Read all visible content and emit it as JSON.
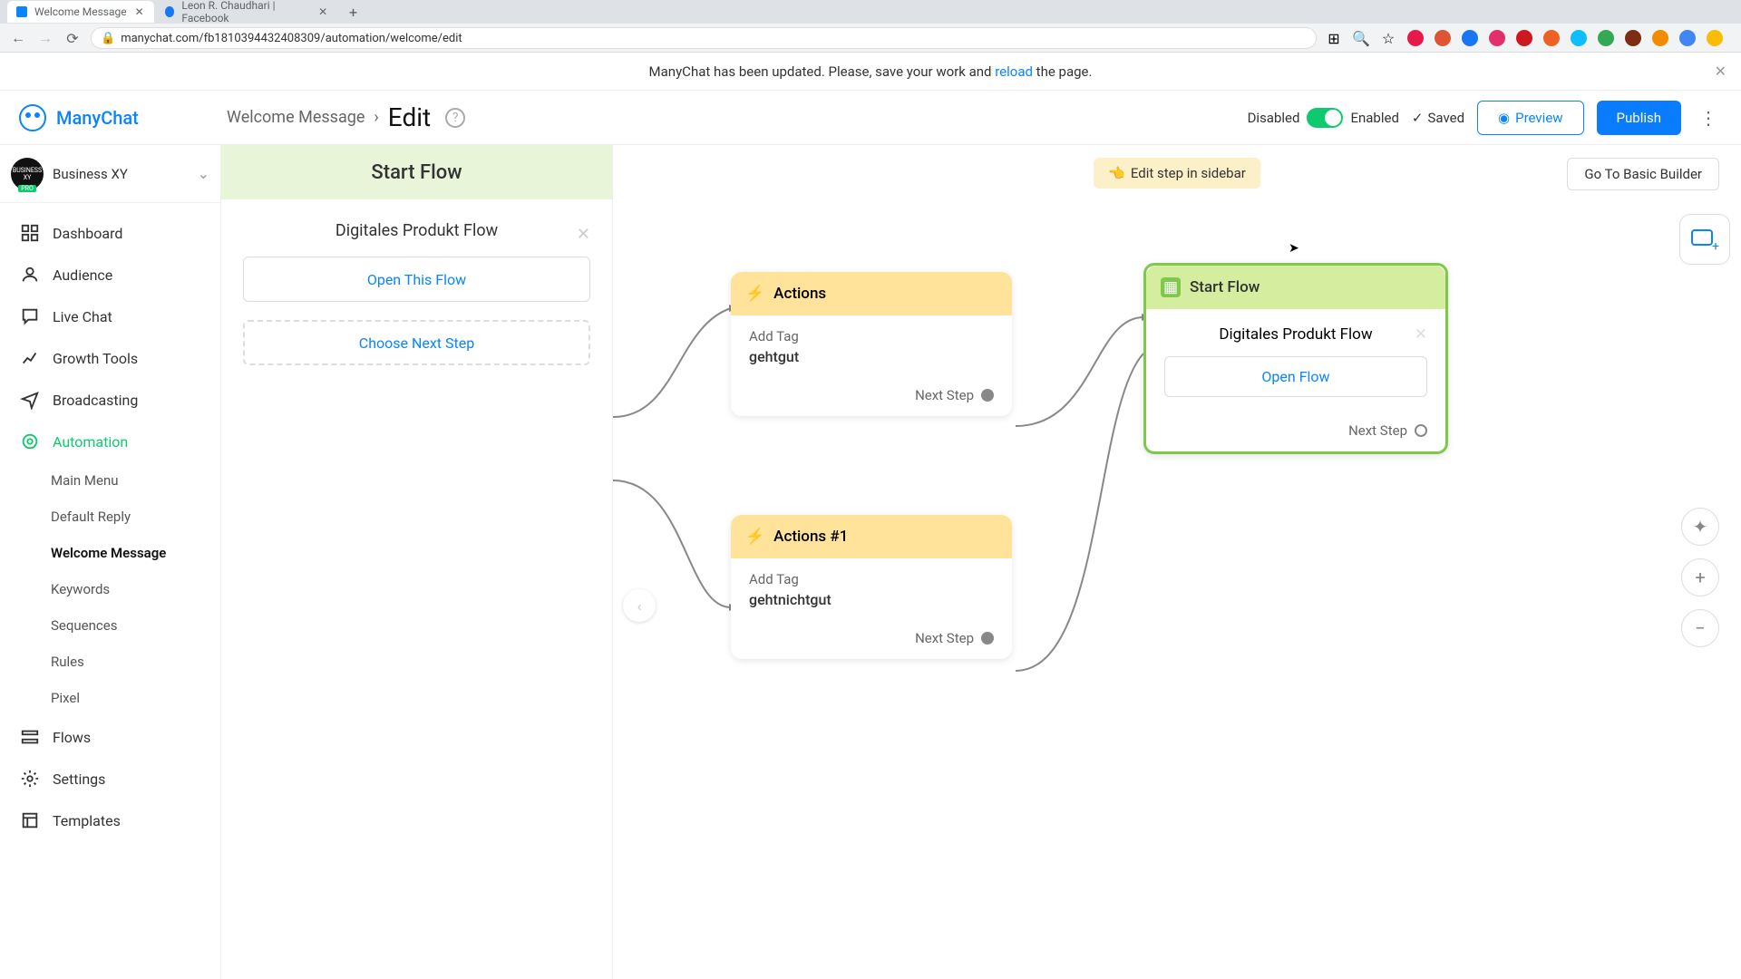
{
  "browser": {
    "tabs": [
      {
        "title": "Welcome Message",
        "active": true,
        "icon": "#0a84ff"
      },
      {
        "title": "Leon R. Chaudhari | Facebook",
        "active": false,
        "icon": "#1877f2"
      }
    ],
    "url": "manychat.com/fb1810394432408309/automation/welcome/edit"
  },
  "notif": {
    "pre": "ManyChat has been updated. Please, save your work and ",
    "link": "reload",
    "post": " the page."
  },
  "brand": "ManyChat",
  "crumb": {
    "parent": "Welcome Message",
    "current": "Edit"
  },
  "toggle": {
    "off": "Disabled",
    "on": "Enabled"
  },
  "saved": "Saved",
  "preview": "Preview",
  "publish": "Publish",
  "workspace": {
    "name": "Business XY",
    "badge": "PRO",
    "logo": "BUSINESS XY"
  },
  "nav": [
    {
      "label": "Dashboard",
      "icon": "dashboard"
    },
    {
      "label": "Audience",
      "icon": "audience"
    },
    {
      "label": "Live Chat",
      "icon": "chat"
    },
    {
      "label": "Growth Tools",
      "icon": "growth"
    },
    {
      "label": "Broadcasting",
      "icon": "broadcast"
    },
    {
      "label": "Automation",
      "icon": "automation",
      "active": true,
      "sub": [
        {
          "label": "Main Menu"
        },
        {
          "label": "Default Reply"
        },
        {
          "label": "Welcome Message",
          "selected": true
        },
        {
          "label": "Keywords"
        },
        {
          "label": "Sequences"
        },
        {
          "label": "Rules"
        },
        {
          "label": "Pixel"
        }
      ]
    },
    {
      "label": "Flows",
      "icon": "flows"
    },
    {
      "label": "Settings",
      "icon": "settings"
    },
    {
      "label": "Templates",
      "icon": "templates"
    }
  ],
  "inspector": {
    "title": "Start Flow",
    "flow": "Digitales Produkt Flow",
    "open": "Open This Flow",
    "choose": "Choose Next Step"
  },
  "canvas": {
    "hint": "Edit step in sidebar",
    "hint_icon": "👈",
    "go_basic": "Go To Basic Builder",
    "nodes": {
      "a1": {
        "title": "Actions",
        "sub": "Add Tag",
        "val": "gehtgut",
        "next": "Next Step"
      },
      "a2": {
        "title": "Actions #1",
        "sub": "Add Tag",
        "val": "gehtnichtgut",
        "next": "Next Step"
      },
      "start": {
        "title": "Start Flow",
        "flow": "Digitales Produkt Flow",
        "open": "Open Flow",
        "next": "Next Step"
      }
    }
  }
}
